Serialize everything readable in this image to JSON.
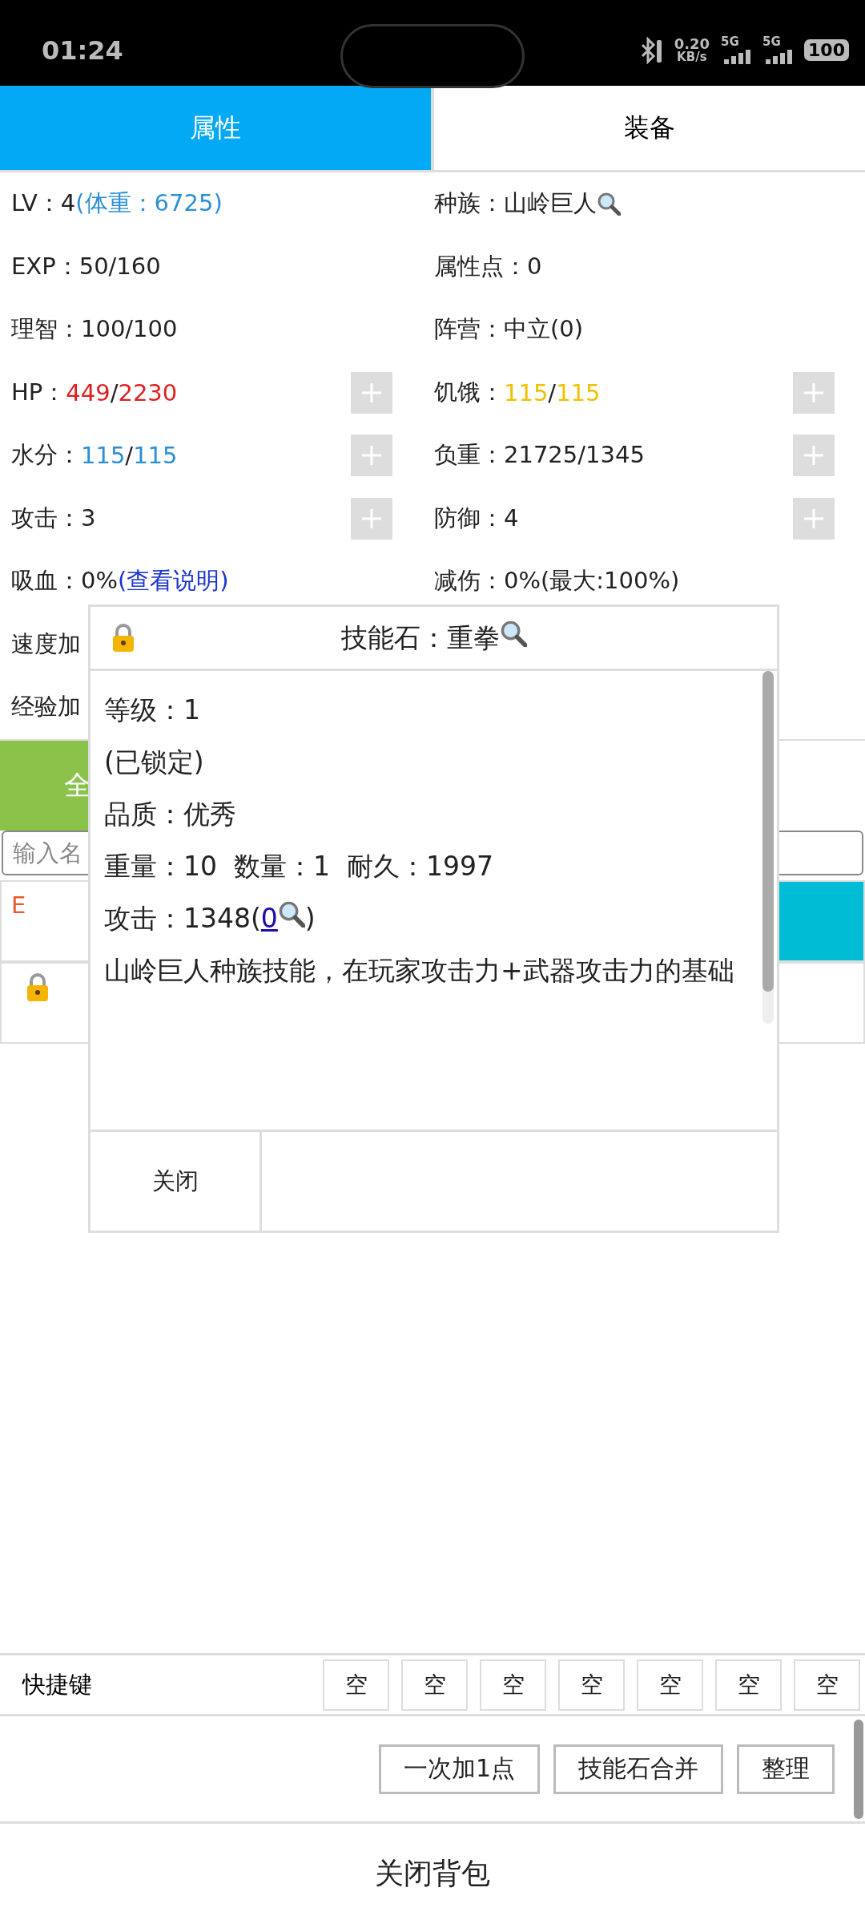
{
  "status_bar": {
    "time": "01:24",
    "net_speed": "0.20",
    "net_unit": "KB/s",
    "sim1": "5G",
    "sim2": "5G",
    "battery": "100"
  },
  "tabs": [
    {
      "label": "属性",
      "selected": true
    },
    {
      "label": "装备",
      "selected": false
    }
  ],
  "stats": [
    {
      "segments": [
        {
          "text": "LV：4"
        },
        {
          "text": "(体重：6725)",
          "color": "#2b8fd6"
        }
      ],
      "plus": false
    },
    {
      "segments": [
        {
          "text": "种族：山岭巨人"
        },
        {
          "kind": "search_icon"
        }
      ],
      "plus": false
    },
    {
      "segments": [
        {
          "text": "EXP：50/160"
        }
      ],
      "plus": false
    },
    {
      "segments": [
        {
          "text": "属性点：0"
        }
      ],
      "plus": false
    },
    {
      "segments": [
        {
          "text": "理智：100/100"
        }
      ],
      "plus": false
    },
    {
      "segments": [
        {
          "text": "阵营：中立(0)"
        }
      ],
      "plus": false
    },
    {
      "segments": [
        {
          "text": "HP："
        },
        {
          "text": "449",
          "color": "#e02020"
        },
        {
          "text": "/"
        },
        {
          "text": "2230",
          "color": "#e02020"
        }
      ],
      "plus": true
    },
    {
      "segments": [
        {
          "text": "饥饿："
        },
        {
          "text": "115",
          "color": "#f0c000"
        },
        {
          "text": "/"
        },
        {
          "text": "115",
          "color": "#f0c000"
        }
      ],
      "plus": true
    },
    {
      "segments": [
        {
          "text": "水分："
        },
        {
          "text": "115",
          "color": "#2b8fd6"
        },
        {
          "text": "/"
        },
        {
          "text": "115",
          "color": "#2b8fd6"
        }
      ],
      "plus": true
    },
    {
      "segments": [
        {
          "text": "负重：21725/1345"
        }
      ],
      "plus": true
    },
    {
      "segments": [
        {
          "text": "攻击：3"
        }
      ],
      "plus": true
    },
    {
      "segments": [
        {
          "text": "防御：4"
        }
      ],
      "plus": true
    },
    {
      "segments": [
        {
          "text": "吸血：0%"
        },
        {
          "text": "(查看说明)",
          "kind": "link"
        }
      ],
      "plus": false
    },
    {
      "segments": [
        {
          "text": "减伤：0%(最大:100%)"
        }
      ],
      "plus": false
    },
    {
      "segments": [
        {
          "text": "速度加"
        }
      ],
      "plus": false
    },
    {
      "plus": false
    },
    {
      "segments": [
        {
          "text": "经验加"
        }
      ],
      "plus": false
    },
    {
      "plus": false
    }
  ],
  "action_bar": {
    "left": "全"
  },
  "search": {
    "placeholder": "输入名"
  },
  "items": [
    {
      "kind": "letter",
      "text": "E"
    },
    {
      "kind": "lock"
    }
  ],
  "popup": {
    "title": "技能石：重拳",
    "lines": [
      [
        {
          "text": "等级：1"
        }
      ],
      [
        {
          "text": "(已锁定)"
        }
      ],
      [
        {
          "text": "品质：优秀"
        }
      ],
      [
        {
          "text": "重量：10  数量：1  耐久：1997"
        }
      ],
      [
        {
          "text": "攻击：1348("
        },
        {
          "text": "0",
          "kind": "link"
        },
        {
          "kind": "search_icon"
        },
        {
          "text": ")"
        }
      ],
      [
        {
          "text": "山岭巨人种族技能，在玩家攻击力+武器攻击力的基础"
        }
      ]
    ],
    "close": "关闭"
  },
  "hotkeys": {
    "label": "快捷键",
    "slots": [
      "空",
      "空",
      "空",
      "空",
      "空",
      "空",
      "空"
    ]
  },
  "buttons": [
    "一次加1点",
    "技能石合并",
    "整理"
  ],
  "close_bag": "关闭背包"
}
